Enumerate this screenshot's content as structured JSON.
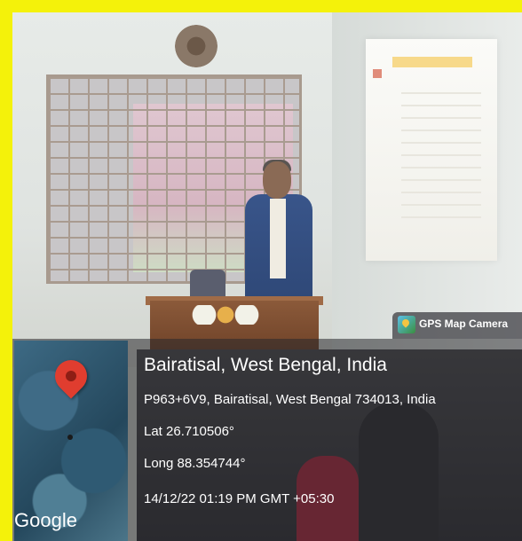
{
  "overlay": {
    "place_title": "Bairatisal, West Bengal, India",
    "address": "P963+6V9, Bairatisal, West Bengal 734013, India",
    "latitude": "Lat 26.710506°",
    "longitude": "Long 88.354744°",
    "timestamp": "14/12/22 01:19 PM GMT +05:30",
    "map_brand": "Google",
    "app_badge": "GPS Map Camera"
  },
  "colors": {
    "border": "#f4f20a",
    "pin": "#e03d2f",
    "overlay_text": "#ffffff"
  }
}
